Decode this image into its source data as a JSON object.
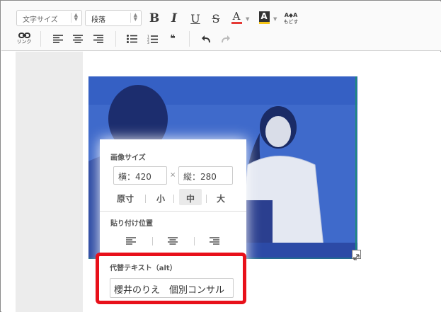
{
  "toolbar": {
    "font_size_select": "文字サイズ",
    "paragraph_select": "段落",
    "bold": "B",
    "italic": "I",
    "underline": "U",
    "strike": "S",
    "text_color": "A",
    "bg_color": "A",
    "ruby_top": "A◆A",
    "ruby_bottom": "もどす",
    "link_label": "リンク",
    "quote": "❛❛"
  },
  "image_popup": {
    "size_title": "画像サイズ",
    "width_value": "横：420",
    "times": "×",
    "height_value": "縦：280",
    "sizes": [
      "原寸",
      "小",
      "中",
      "大"
    ],
    "active_size": "中",
    "paste_position_title": "貼り付け位置",
    "alt_title": "代替テキスト（alt）",
    "alt_value": "櫻井のりえ　個別コンサル"
  },
  "colors": {
    "photo_tint": "#3d67c9",
    "highlight_border": "#e8101a",
    "text_color_underline": "#e53935",
    "bg_color_underline": "#f5c518"
  }
}
